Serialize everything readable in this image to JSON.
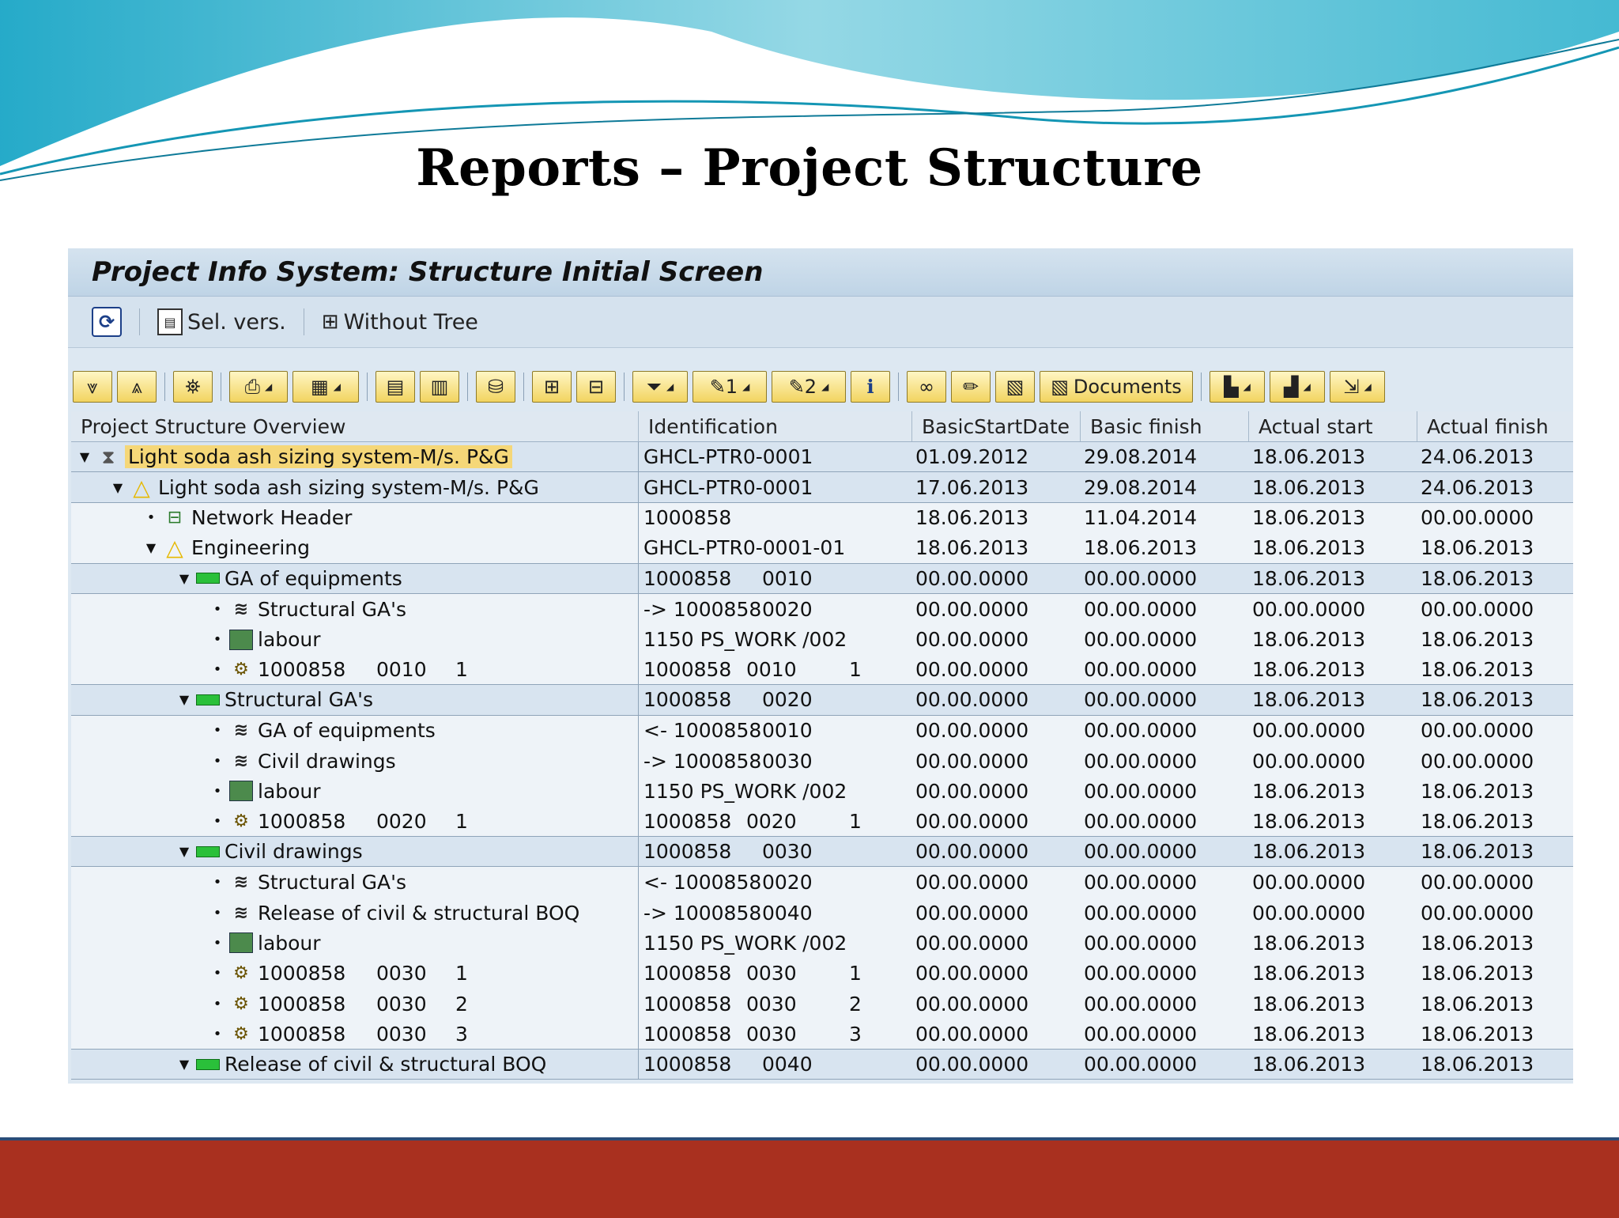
{
  "slide": {
    "title": "Reports – Project Structure"
  },
  "window": {
    "title": "Project Info System: Structure Initial Screen"
  },
  "app_toolbar": {
    "sel_vers_label": "Sel. vers.",
    "without_tree_label": "Without Tree"
  },
  "alv_toolbar": {
    "filter1_label": "1",
    "filter2_label": "2",
    "documents_label": "Documents"
  },
  "columns": {
    "c0": "Project Structure Overview",
    "c1": "Identification",
    "c2": "BasicStartDate",
    "c3": "Basic finish",
    "c4": "Actual start",
    "c5": "Actual finish"
  },
  "rows": [
    {
      "name": "Light soda ash sizing system-M/s. P&G",
      "id": "GHCL-PTR0-0001",
      "bs": "01.09.2012",
      "bf": "29.08.2014",
      "as": "18.06.2013",
      "af": "24.06.2013"
    },
    {
      "name": "Light soda ash sizing system-M/s. P&G",
      "id": "GHCL-PTR0-0001",
      "bs": "17.06.2013",
      "bf": "29.08.2014",
      "as": "18.06.2013",
      "af": "24.06.2013"
    },
    {
      "name": "Network Header",
      "id": "1000858",
      "bs": "18.06.2013",
      "bf": "11.04.2014",
      "as": "18.06.2013",
      "af": "00.00.0000"
    },
    {
      "name": "Engineering",
      "id": "GHCL-PTR0-0001-01",
      "bs": "18.06.2013",
      "bf": "18.06.2013",
      "as": "18.06.2013",
      "af": "18.06.2013"
    },
    {
      "name": "GA of equipments",
      "id1": "1000858",
      "id2": "0010",
      "bs": "00.00.0000",
      "bf": "00.00.0000",
      "as": "18.06.2013",
      "af": "18.06.2013"
    },
    {
      "name": "Structural GA's",
      "id1": "-> 1000858",
      "id2": "0020",
      "bs": "00.00.0000",
      "bf": "00.00.0000",
      "as": "00.00.0000",
      "af": "00.00.0000"
    },
    {
      "name": "labour",
      "id": "1150 PS_WORK /002",
      "bs": "00.00.0000",
      "bf": "00.00.0000",
      "as": "18.06.2013",
      "af": "18.06.2013"
    },
    {
      "n1": "1000858",
      "n2": "0010",
      "n3": "1",
      "id1": "1000858",
      "id2": "0010",
      "id3": "1",
      "bs": "00.00.0000",
      "bf": "00.00.0000",
      "as": "18.06.2013",
      "af": "18.06.2013"
    },
    {
      "name": "Structural GA's",
      "id1": "1000858",
      "id2": "0020",
      "bs": "00.00.0000",
      "bf": "00.00.0000",
      "as": "18.06.2013",
      "af": "18.06.2013"
    },
    {
      "name": "GA of equipments",
      "id1": "<- 1000858",
      "id2": "0010",
      "bs": "00.00.0000",
      "bf": "00.00.0000",
      "as": "00.00.0000",
      "af": "00.00.0000"
    },
    {
      "name": "Civil drawings",
      "id1": "-> 1000858",
      "id2": "0030",
      "bs": "00.00.0000",
      "bf": "00.00.0000",
      "as": "00.00.0000",
      "af": "00.00.0000"
    },
    {
      "name": "labour",
      "id": "1150 PS_WORK /002",
      "bs": "00.00.0000",
      "bf": "00.00.0000",
      "as": "18.06.2013",
      "af": "18.06.2013"
    },
    {
      "n1": "1000858",
      "n2": "0020",
      "n3": "1",
      "id1": "1000858",
      "id2": "0020",
      "id3": "1",
      "bs": "00.00.0000",
      "bf": "00.00.0000",
      "as": "18.06.2013",
      "af": "18.06.2013"
    },
    {
      "name": "Civil drawings",
      "id1": "1000858",
      "id2": "0030",
      "bs": "00.00.0000",
      "bf": "00.00.0000",
      "as": "18.06.2013",
      "af": "18.06.2013"
    },
    {
      "name": "Structural GA's",
      "id1": "<- 1000858",
      "id2": "0020",
      "bs": "00.00.0000",
      "bf": "00.00.0000",
      "as": "00.00.0000",
      "af": "00.00.0000"
    },
    {
      "name": "Release of civil & structural BOQ",
      "id1": "-> 1000858",
      "id2": "0040",
      "bs": "00.00.0000",
      "bf": "00.00.0000",
      "as": "00.00.0000",
      "af": "00.00.0000"
    },
    {
      "name": "labour",
      "id": "1150 PS_WORK /002",
      "bs": "00.00.0000",
      "bf": "00.00.0000",
      "as": "18.06.2013",
      "af": "18.06.2013"
    },
    {
      "n1": "1000858",
      "n2": "0030",
      "n3": "1",
      "id1": "1000858",
      "id2": "0030",
      "id3": "1",
      "bs": "00.00.0000",
      "bf": "00.00.0000",
      "as": "18.06.2013",
      "af": "18.06.2013"
    },
    {
      "n1": "1000858",
      "n2": "0030",
      "n3": "2",
      "id1": "1000858",
      "id2": "0030",
      "id3": "2",
      "bs": "00.00.0000",
      "bf": "00.00.0000",
      "as": "18.06.2013",
      "af": "18.06.2013"
    },
    {
      "n1": "1000858",
      "n2": "0030",
      "n3": "3",
      "id1": "1000858",
      "id2": "0030",
      "id3": "3",
      "bs": "00.00.0000",
      "bf": "00.00.0000",
      "as": "18.06.2013",
      "af": "18.06.2013"
    },
    {
      "name": "Release of civil & structural BOQ",
      "id1": "1000858",
      "id2": "0040",
      "bs": "00.00.0000",
      "bf": "00.00.0000",
      "as": "18.06.2013",
      "af": "18.06.2013"
    }
  ],
  "colors": {
    "footer": "#a9301f",
    "highlight": "#f5d778",
    "wave": "#2fb3cf"
  }
}
